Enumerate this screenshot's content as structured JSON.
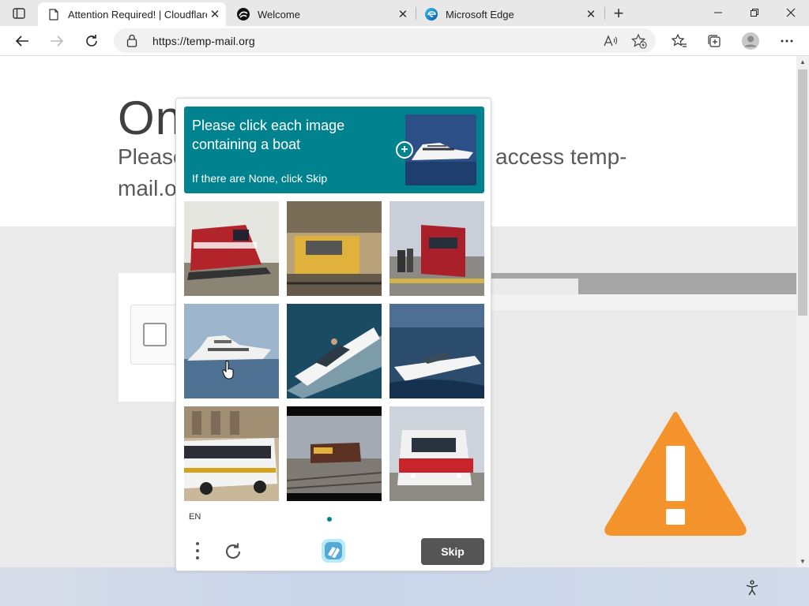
{
  "browser": {
    "tabs": [
      {
        "title": "Attention Required! | Cloudflare",
        "close": "✕",
        "active": true,
        "icon": "document-icon"
      },
      {
        "title": "Welcome",
        "close": "✕",
        "active": false,
        "icon": "brand-swirl-icon"
      },
      {
        "title": "Microsoft Edge",
        "close": "✕",
        "active": false,
        "icon": "edge-icon"
      }
    ],
    "new_tab": "+",
    "address": {
      "url": "https://temp-mail.org"
    }
  },
  "page": {
    "heading": "On",
    "subtext_line1_start": "Please",
    "subtext_line1_end": "access temp-",
    "subtext_line2": "mail.o"
  },
  "captcha": {
    "prompt": "Please click each image containing a boat",
    "sub_prompt": "If there are None, click Skip",
    "language": "EN",
    "skip_label": "Skip",
    "accent_color": "#00838f",
    "images": [
      {
        "subject": "train"
      },
      {
        "subject": "train"
      },
      {
        "subject": "train"
      },
      {
        "subject": "boat"
      },
      {
        "subject": "boat"
      },
      {
        "subject": "boat"
      },
      {
        "subject": "bus"
      },
      {
        "subject": "train"
      },
      {
        "subject": "train"
      }
    ]
  },
  "colors": {
    "warning": "#f4922b",
    "teal": "#00838f"
  }
}
